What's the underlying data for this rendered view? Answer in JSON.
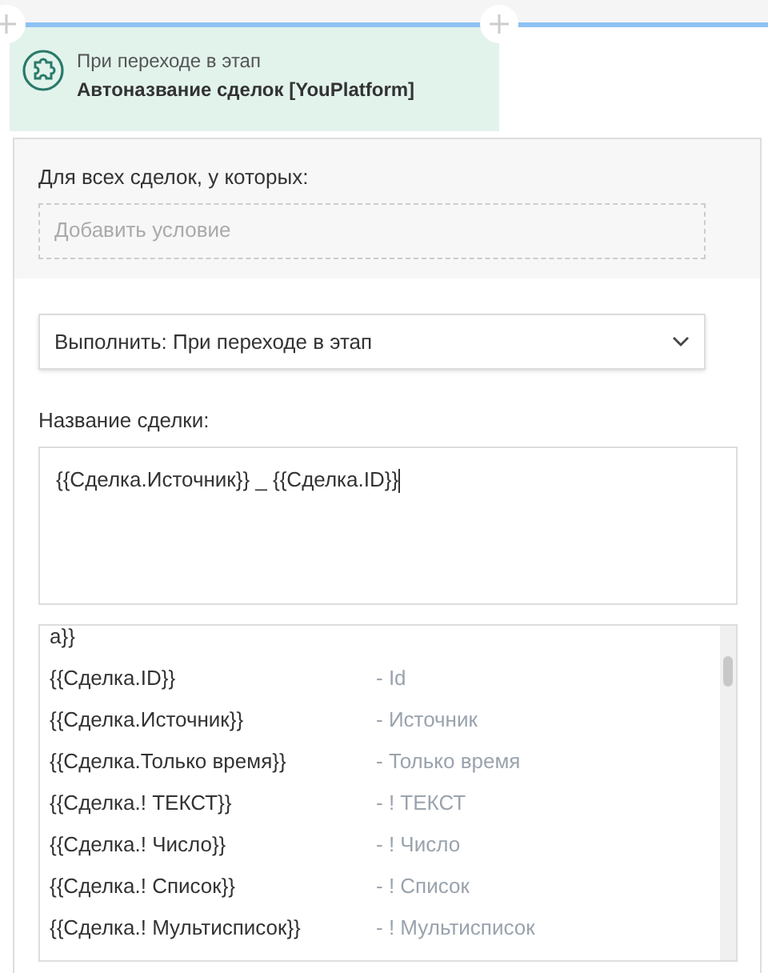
{
  "trigger_card": {
    "subtitle": "При переходе в этап",
    "title": "Автоназвание сделок [YouPlatform]"
  },
  "conditions": {
    "label": "Для всех сделок, у которых:",
    "placeholder": "Добавить условие"
  },
  "execute_select": {
    "value": "Выполнить: При переходе в этап"
  },
  "deal_name": {
    "label": "Название сделки:",
    "value": "{{Сделка.Источник}} _ {{Сделка.ID}}"
  },
  "variables": [
    {
      "token": "а}}"
    },
    {
      "token": "{{Сделка.ID}}",
      "description": "- Id"
    },
    {
      "token": "{{Сделка.Источник}}",
      "description": "- Источник"
    },
    {
      "token": "{{Сделка.Только время}}",
      "description": "- Только время"
    },
    {
      "token": "{{Сделка.! ТЕКСТ}}",
      "description": "- ! ТЕКСТ"
    },
    {
      "token": "{{Сделка.! Число}}",
      "description": "- ! Число"
    },
    {
      "token": "{{Сделка.! Список}}",
      "description": "- ! Список"
    },
    {
      "token": "{{Сделка.! Мультисписок}}",
      "description": "- ! Мультисписок"
    }
  ]
}
